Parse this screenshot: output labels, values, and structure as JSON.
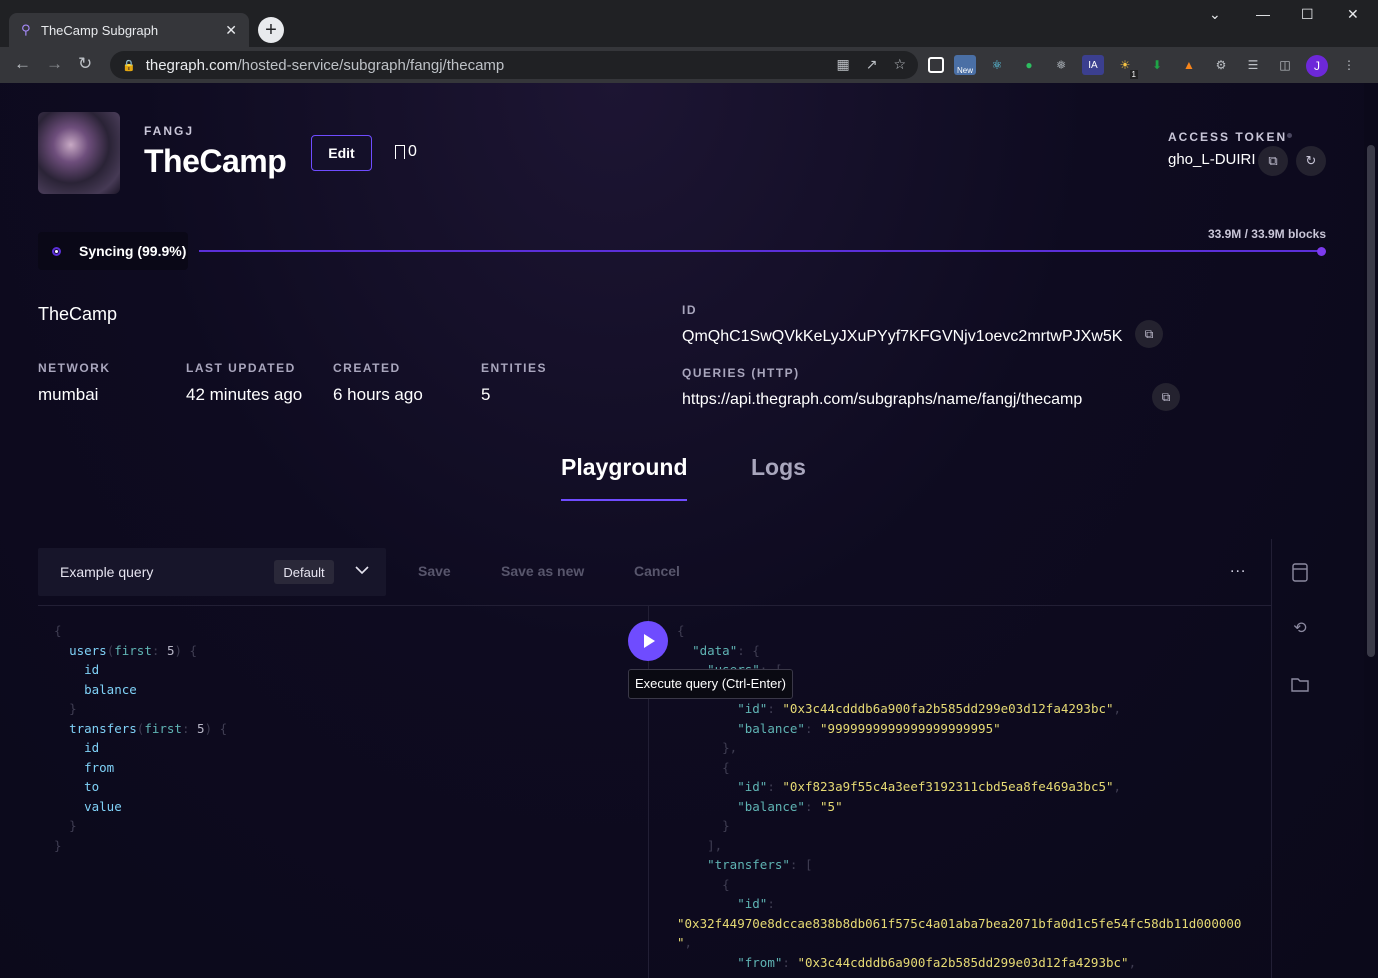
{
  "browser": {
    "tab_title": "TheCamp Subgraph",
    "url_host": "thegraph.com",
    "url_path": "/hosted-service/subgraph/fangj/thecamp",
    "avatar_letter": "J",
    "ext_new_label": "New",
    "ext_badge": "1"
  },
  "header": {
    "owner": "FANGJ",
    "name": "TheCamp",
    "edit_label": "Edit",
    "bookmark_count": "0",
    "access_token_label": "ACCESS TOKEN",
    "access_token_value": "gho_L-DUIRI"
  },
  "sync": {
    "status": "Syncing (99.9%)",
    "progress": 0.999,
    "blocks": "33.9M / 33.9M blocks"
  },
  "details": {
    "display_name": "TheCamp",
    "network_label": "NETWORK",
    "network": "mumbai",
    "last_updated_label": "LAST UPDATED",
    "last_updated": "42 minutes ago",
    "created_label": "CREATED",
    "created": "6 hours ago",
    "entities_label": "ENTITIES",
    "entities": "5",
    "id_label": "ID",
    "id": "QmQhC1SwQVkKeLyJXuPYyf7KFGVNjv1oevc2mrtwPJXw5K",
    "queries_label": "QUERIES (HTTP)",
    "queries_url": "https://api.thegraph.com/subgraphs/name/fangj/thecamp"
  },
  "tabs": {
    "playground": "Playground",
    "logs": "Logs"
  },
  "playground": {
    "query_name": "Example query",
    "default_badge": "Default",
    "save": "Save",
    "save_as_new": "Save as new",
    "cancel": "Cancel",
    "more": "...",
    "execute_tooltip": "Execute query (Ctrl-Enter)"
  },
  "query": {
    "users_field": "users",
    "users_arg": "first",
    "users_arg_val": "5",
    "users_fields": [
      "id",
      "balance"
    ],
    "transfers_field": "transfers",
    "transfers_arg": "first",
    "transfers_arg_val": "5",
    "transfers_fields": [
      "id",
      "from",
      "to",
      "value"
    ]
  },
  "result": {
    "data_key": "\"data\"",
    "users_key": "\"users\"",
    "id_key": "\"id\"",
    "balance_key": "\"balance\"",
    "transfers_key": "\"transfers\"",
    "from_key": "\"from\"",
    "user1_id": "\"0x3c44cdddb6a900fa2b585dd299e03d12fa4293bc\"",
    "user1_balance": "\"9999999999999999999995\"",
    "user2_id": "\"0xf823a9f55c4a3eef3192311cbd5ea8fe469a3bc5\"",
    "user2_balance": "\"5\"",
    "transfer1_id": "\"0x32f44970e8dccae838b8db061f575c4a01aba7bea2071bfa0d1c5fe54fc58db11d000000",
    "transfer1_id_tail": "\"",
    "transfer1_from": "\"0x3c44cdddb6a900fa2b585dd299e03d12fa4293bc\""
  }
}
